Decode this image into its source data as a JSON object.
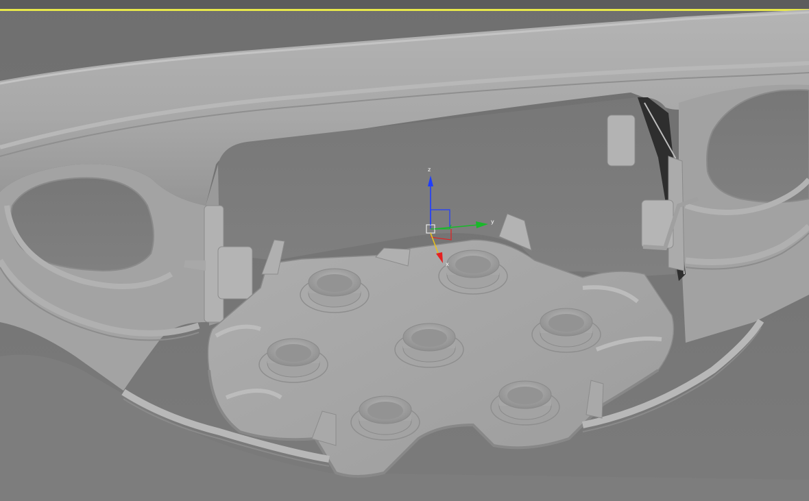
{
  "viewport": {
    "active_border_color": "#e8e84a",
    "background_color": "#727272",
    "model_color": "#a6a6a6"
  },
  "gizmo": {
    "type": "transform-gizmo",
    "axes": [
      {
        "name": "z",
        "label": "z",
        "color": "#1f3dff"
      },
      {
        "name": "y",
        "label": "y",
        "color": "#19b82a"
      },
      {
        "name": "x",
        "label": "x",
        "color": "#e52020"
      }
    ]
  }
}
